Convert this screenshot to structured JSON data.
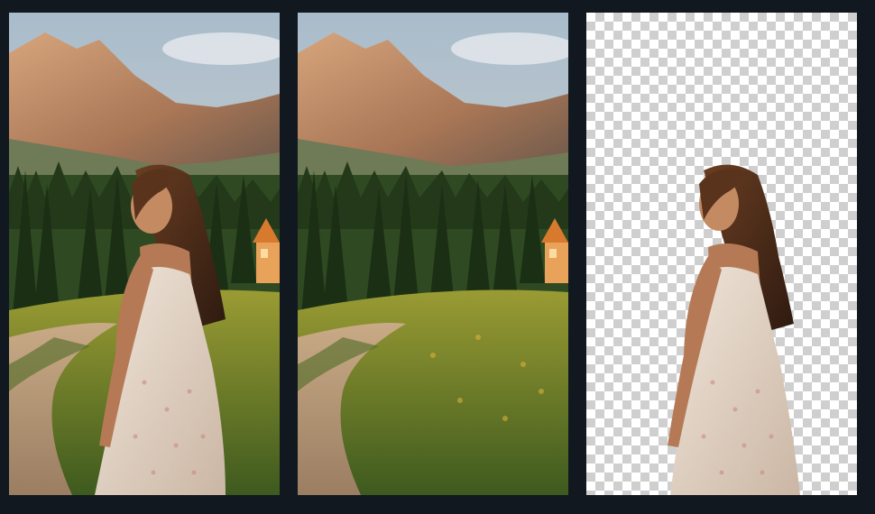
{
  "colors": {
    "background": "#121820",
    "sky": "#b9c7d3",
    "mountain": "#b38060",
    "forest": "#2f4a22",
    "meadow": "#7a8a2a",
    "path": "#b89878",
    "cabin": "#e8a25a",
    "dress": "#e9ddd0",
    "hair": "#4a2a18",
    "skin": "#b57a55",
    "checker_light": "#ffffff",
    "checker_dark": "#cfcfcf"
  },
  "panels": [
    {
      "id": "original",
      "content": "woman-in-landscape",
      "background": "landscape"
    },
    {
      "id": "background-only",
      "content": "landscape",
      "background": "landscape"
    },
    {
      "id": "cutout",
      "content": "woman",
      "background": "transparent-checkerboard"
    }
  ]
}
